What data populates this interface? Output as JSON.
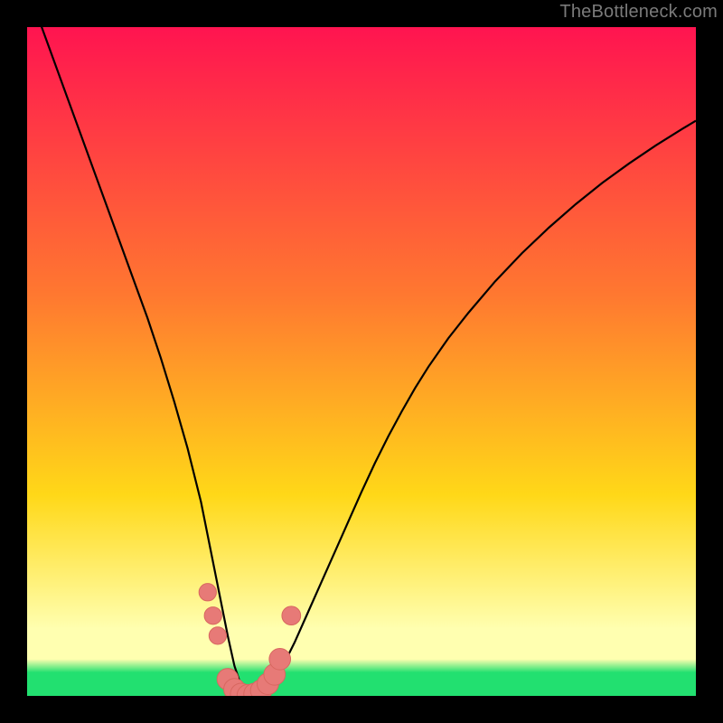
{
  "watermark": "TheBottleneck.com",
  "colors": {
    "black": "#000000",
    "curve": "#000000",
    "marker_fill": "#e77a77",
    "marker_stroke": "#d86760",
    "gradient_top": "#ff1450",
    "gradient_mid1": "#ff7830",
    "gradient_mid2": "#ffd818",
    "gradient_pale": "#ffffb0",
    "gradient_green": "#22e070"
  },
  "chart_data": {
    "type": "line",
    "title": "",
    "xlabel": "",
    "ylabel": "",
    "xlim": [
      0,
      100
    ],
    "ylim": [
      0,
      100
    ],
    "series": [
      {
        "name": "bottleneck-curve",
        "x": [
          0,
          2,
          4,
          6,
          8,
          10,
          12,
          14,
          16,
          18,
          20,
          22,
          24,
          26,
          27,
          28,
          29,
          30,
          31,
          32,
          33,
          34,
          35,
          36,
          38,
          40,
          42,
          44,
          46,
          48,
          50,
          52,
          54,
          56,
          58,
          60,
          63,
          66,
          70,
          74,
          78,
          82,
          86,
          90,
          94,
          98,
          100
        ],
        "values": [
          106,
          100.5,
          95,
          89.5,
          84,
          78.5,
          73,
          67.5,
          62,
          56.5,
          50.5,
          44,
          37,
          29,
          24,
          19,
          14,
          9,
          4.5,
          1.5,
          0,
          0,
          0,
          1,
          4,
          8,
          12.5,
          17,
          21.5,
          26,
          30.5,
          34.8,
          38.8,
          42.5,
          46,
          49.2,
          53.5,
          57.3,
          62,
          66.2,
          70,
          73.5,
          76.7,
          79.6,
          82.3,
          84.8,
          86
        ]
      }
    ],
    "markers": [
      {
        "x": 27.0,
        "y": 15.5,
        "r": 1.3
      },
      {
        "x": 27.8,
        "y": 12.0,
        "r": 1.3
      },
      {
        "x": 28.5,
        "y": 9.0,
        "r": 1.3
      },
      {
        "x": 30.0,
        "y": 2.5,
        "r": 1.6
      },
      {
        "x": 31.0,
        "y": 1.0,
        "r": 1.6
      },
      {
        "x": 32.0,
        "y": 0.3,
        "r": 1.6
      },
      {
        "x": 33.0,
        "y": 0.1,
        "r": 1.6
      },
      {
        "x": 34.0,
        "y": 0.3,
        "r": 1.6
      },
      {
        "x": 35.0,
        "y": 0.8,
        "r": 1.6
      },
      {
        "x": 36.0,
        "y": 1.8,
        "r": 1.6
      },
      {
        "x": 37.0,
        "y": 3.2,
        "r": 1.6
      },
      {
        "x": 37.8,
        "y": 5.5,
        "r": 1.6
      },
      {
        "x": 39.5,
        "y": 12.0,
        "r": 1.4
      }
    ],
    "gradient_stops": [
      {
        "offset": 0.0,
        "key": "gradient_top"
      },
      {
        "offset": 0.4,
        "key": "gradient_mid1"
      },
      {
        "offset": 0.7,
        "key": "gradient_mid2"
      },
      {
        "offset": 0.9,
        "key": "gradient_pale"
      },
      {
        "offset": 0.945,
        "key": "gradient_pale"
      },
      {
        "offset": 0.965,
        "key": "gradient_green"
      },
      {
        "offset": 1.0,
        "key": "gradient_green"
      }
    ]
  }
}
